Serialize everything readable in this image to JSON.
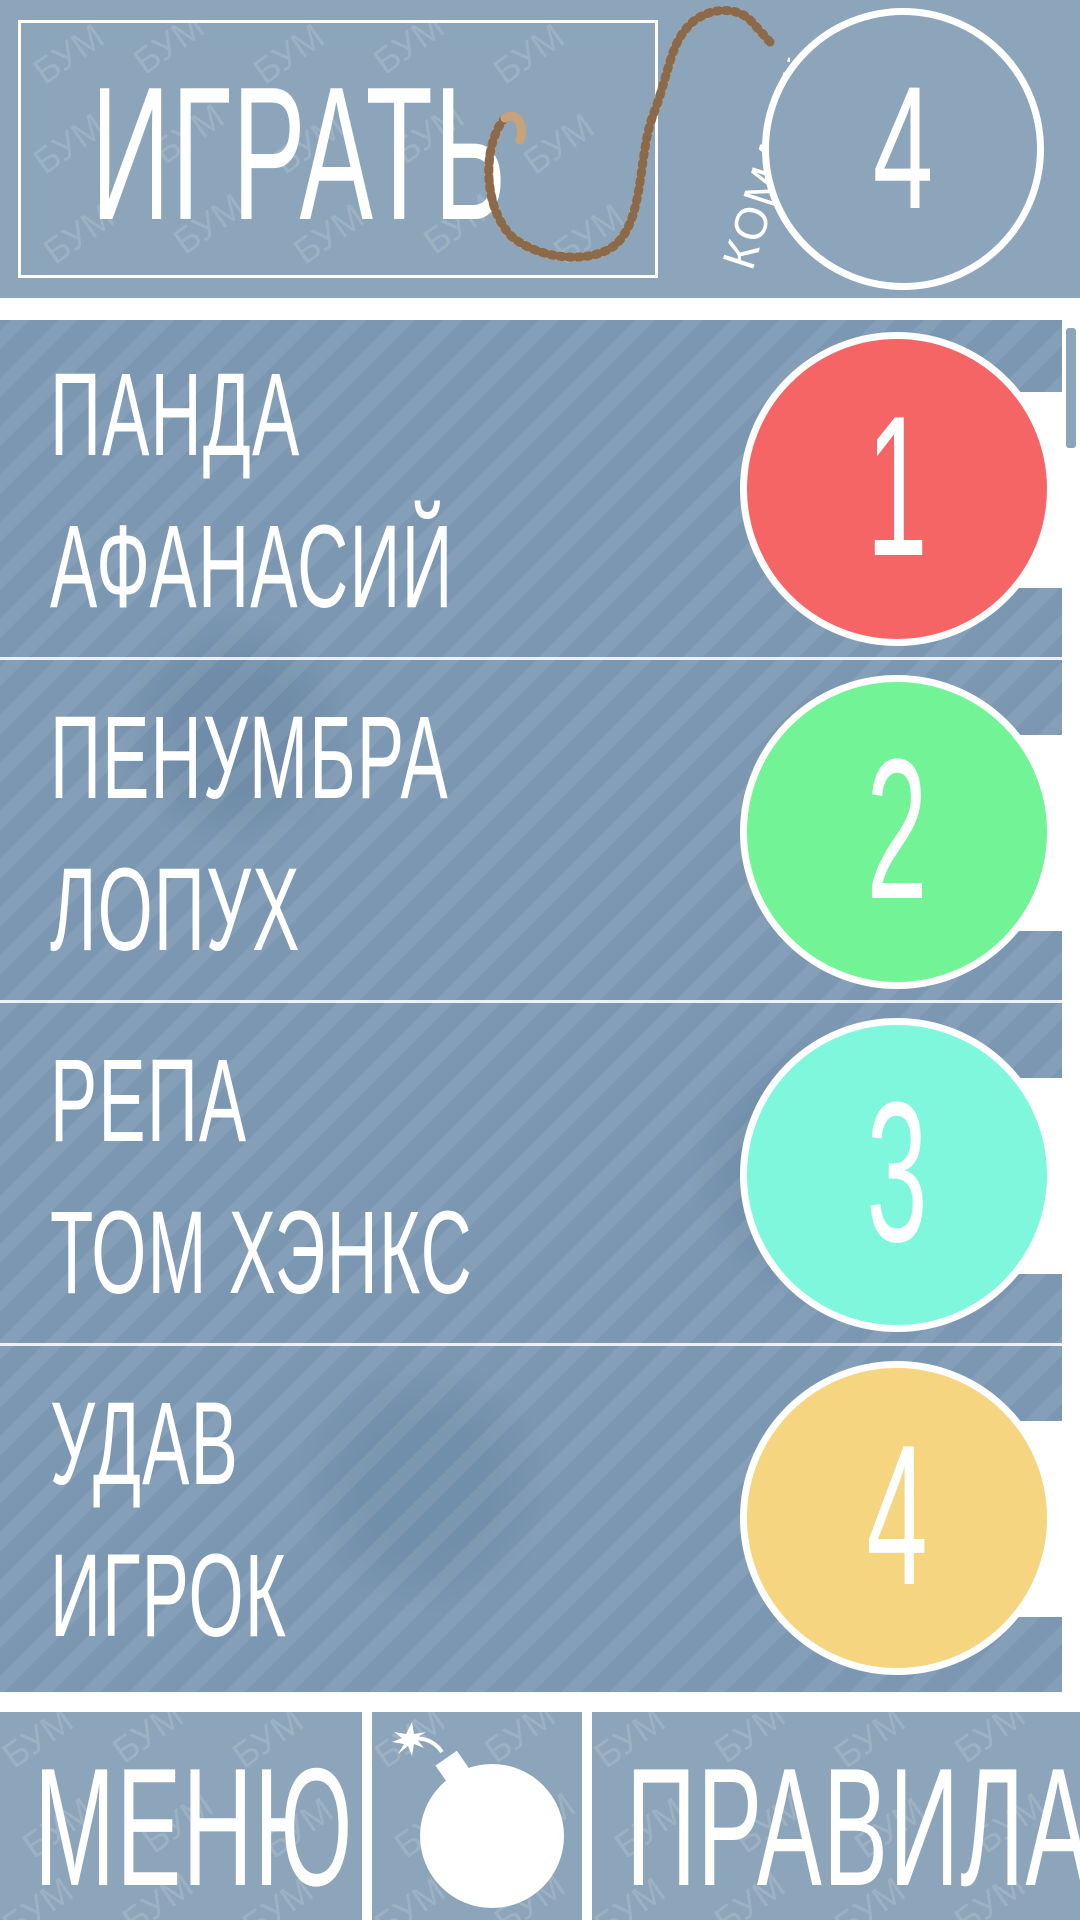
{
  "header": {
    "watermark_word": "БУМ",
    "play_label": "ИГРАТЬ",
    "teams_label": "КОМАНДЫ",
    "teams_count": "4"
  },
  "teams": [
    {
      "number": "1",
      "player1": "ПАНДА",
      "player2": "АФАНАСИЙ",
      "color": "#f66566"
    },
    {
      "number": "2",
      "player1": "ПЕНУМБРА",
      "player2": "ЛОПУХ",
      "color": "#72f496"
    },
    {
      "number": "3",
      "player1": "РЕПА",
      "player2": "ТОМ ХЭНКС",
      "color": "#7ef7dc"
    },
    {
      "number": "4",
      "player1": "УДАВ",
      "player2": "ИГРОК",
      "color": "#f5d57f"
    }
  ],
  "footer": {
    "menu_label": "МЕНЮ",
    "bomb_icon": "bomb-icon",
    "rules_label": "ПРАВИЛА"
  },
  "colors": {
    "panel": "#8ca5ba",
    "list_bg": "#7b97b2",
    "rope": "#c9a27a"
  }
}
